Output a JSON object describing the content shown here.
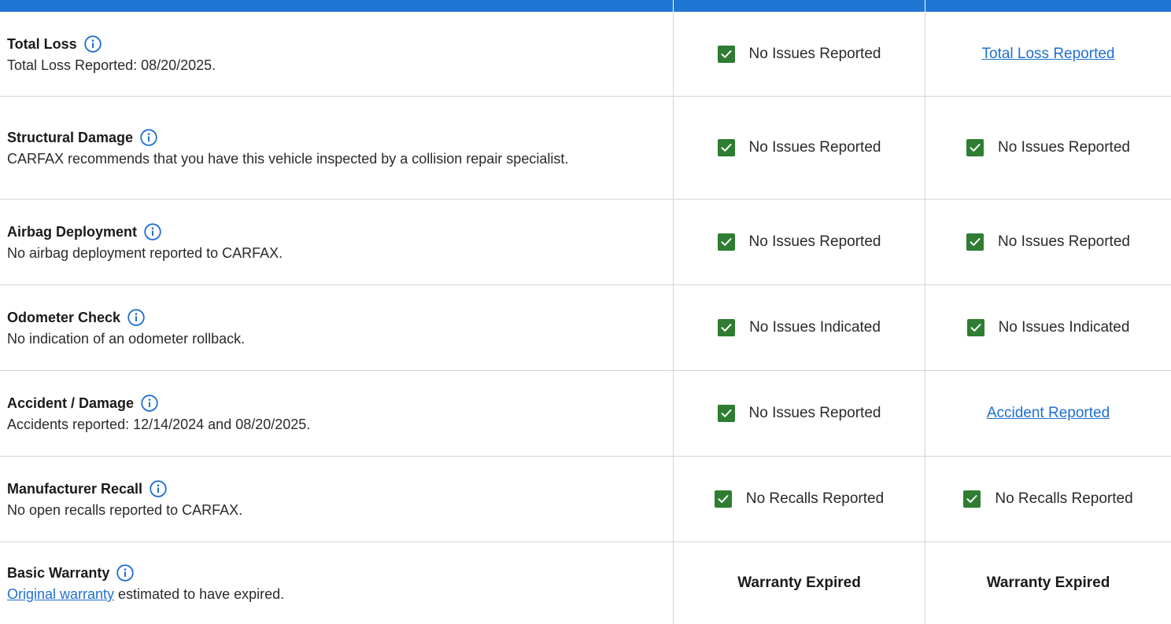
{
  "colors": {
    "header_blue": "#1f76d2",
    "check_green": "#2e7d32",
    "link_blue": "#1f6fd1",
    "divider": "#d4d4d4"
  },
  "rows": [
    {
      "title": "Total Loss",
      "description": "Total Loss Reported: 08/20/2025.",
      "col1": {
        "type": "check",
        "text": "No Issues Reported",
        "icon": "check-icon"
      },
      "col2": {
        "type": "link",
        "text": "Total Loss Reported"
      }
    },
    {
      "title": "Structural Damage",
      "description": "CARFAX recommends that you have this vehicle inspected by a collision repair specialist.",
      "col1": {
        "type": "check",
        "text": "No Issues Reported",
        "icon": "check-icon"
      },
      "col2": {
        "type": "check",
        "text": "No Issues Reported",
        "icon": "check-icon"
      }
    },
    {
      "title": "Airbag Deployment",
      "description": "No airbag deployment reported to CARFAX.",
      "col1": {
        "type": "check",
        "text": "No Issues Reported",
        "icon": "check-icon"
      },
      "col2": {
        "type": "check",
        "text": "No Issues Reported",
        "icon": "check-icon"
      }
    },
    {
      "title": "Odometer Check",
      "description": "No indication of an odometer rollback.",
      "col1": {
        "type": "check",
        "text": "No Issues Indicated",
        "icon": "check-icon"
      },
      "col2": {
        "type": "check",
        "text": "No Issues Indicated",
        "icon": "check-icon"
      }
    },
    {
      "title": "Accident / Damage",
      "description": "Accidents reported: 12/14/2024 and 08/20/2025.",
      "col1": {
        "type": "check",
        "text": "No Issues Reported",
        "icon": "check-icon"
      },
      "col2": {
        "type": "link",
        "text": "Accident Reported"
      }
    },
    {
      "title": "Manufacturer Recall",
      "description": "No open recalls reported to CARFAX.",
      "col1": {
        "type": "check",
        "text": "No Recalls Reported",
        "icon": "check-icon"
      },
      "col2": {
        "type": "check",
        "text": "No Recalls Reported",
        "icon": "check-icon"
      }
    },
    {
      "title": "Basic Warranty",
      "description_link": "Original warranty",
      "description": " estimated to have expired.",
      "col1": {
        "type": "bold",
        "text": "Warranty Expired"
      },
      "col2": {
        "type": "bold",
        "text": "Warranty Expired"
      }
    }
  ]
}
